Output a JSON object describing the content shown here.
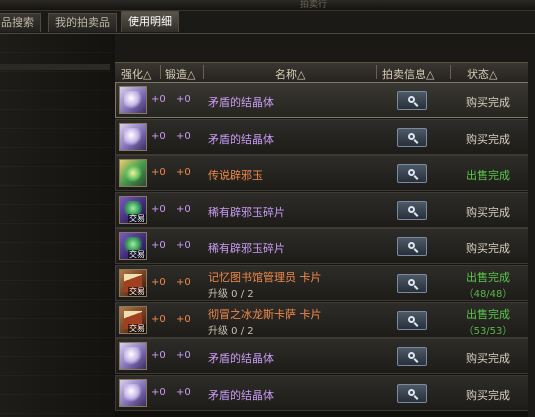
{
  "window": {
    "title": "拍卖行"
  },
  "tabs": [
    {
      "label": "品搜索",
      "active": false
    },
    {
      "label": "我的拍卖品",
      "active": false
    },
    {
      "label": "使用明细",
      "active": true
    }
  ],
  "table": {
    "headers": [
      "强化△",
      "锻造△",
      "名称△",
      "拍卖信息△",
      "状态△"
    ],
    "rows": [
      {
        "icon": "crystal-icon",
        "reinforce": "+0",
        "forge": "+0",
        "name": "矛盾的结晶体",
        "name_color": "#c89cf4",
        "status": "购买完成",
        "status_color": "#d8d0c0",
        "selected": true
      },
      {
        "icon": "crystal-icon",
        "reinforce": "+0",
        "forge": "+0",
        "name": "矛盾的结晶体",
        "name_color": "#c89cf4",
        "status": "购买完成",
        "status_color": "#d8d0c0"
      },
      {
        "icon": "jade-icon",
        "reinforce": "+0",
        "forge": "+0",
        "name": "传说辟邪玉",
        "name_color": "#f08a4a",
        "status": "出售完成",
        "status_color": "#58c848"
      },
      {
        "icon": "jade-shard-icon",
        "reinforce": "+0",
        "forge": "+0",
        "name": "稀有辟邪玉碎片",
        "name_color": "#c89cf4",
        "status": "购买完成",
        "status_color": "#d8d0c0",
        "trade": "交易"
      },
      {
        "icon": "jade-shard-icon",
        "reinforce": "+0",
        "forge": "+0",
        "name": "稀有辟邪玉碎片",
        "name_color": "#c89cf4",
        "status": "购买完成",
        "status_color": "#d8d0c0",
        "trade": "交易"
      },
      {
        "icon": "card-icon",
        "reinforce": "+0",
        "forge": "+0",
        "name": "记忆图书馆管理员 卡片",
        "name_color": "#f08a4a",
        "sub": "升级 0 / 2",
        "status": "出售完成",
        "status_color": "#58c848",
        "count": "（48/48）",
        "trade": "交易"
      },
      {
        "icon": "card-icon",
        "reinforce": "+0",
        "forge": "+0",
        "name": "彻冒之冰龙斯卡萨  卡片",
        "name_color": "#f08a4a",
        "sub": "升级 0 / 2",
        "status": "出售完成",
        "status_color": "#58c848",
        "count": "（53/53）",
        "trade": "交易"
      },
      {
        "icon": "crystal-icon",
        "reinforce": "+0",
        "forge": "+0",
        "name": "矛盾的结晶体",
        "name_color": "#c89cf4",
        "status": "购买完成",
        "status_color": "#d8d0c0"
      },
      {
        "icon": "crystal-icon",
        "reinforce": "+0",
        "forge": "+0",
        "name": "矛盾的结晶体",
        "name_color": "#c89cf4",
        "status": "购买完成",
        "status_color": "#d8d0c0"
      }
    ]
  },
  "colors": {
    "plus": "#c89cf4",
    "plus_orange": "#f08a4a"
  }
}
